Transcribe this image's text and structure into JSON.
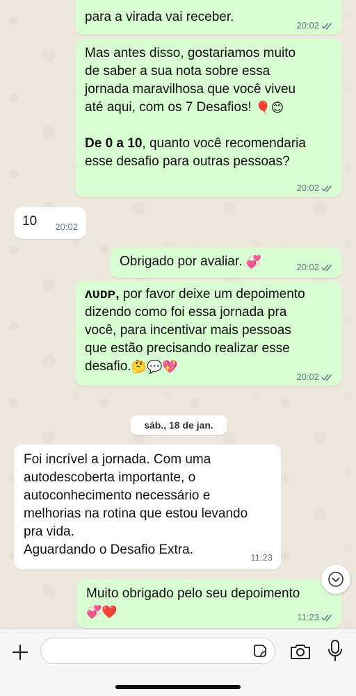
{
  "messages": [
    {
      "id": "m1",
      "text": "para a virada vai receber.",
      "time": "20:02"
    },
    {
      "id": "m2",
      "lines": [
        "Mas antes disso, gostariamos muito",
        "de saber a sua nota sobre essa",
        "jornada maravilhosa que você viveu",
        "até aqui, com os 7 Desafios!"
      ],
      "emoji_end": "🎈😊",
      "bold_part": "De 0 a 10",
      "after_bold": ", quanto você recomendaria",
      "last_line": "esse desafio para outras pessoas?",
      "time": "20:02"
    },
    {
      "id": "m3",
      "text": "10",
      "time": "20:02"
    },
    {
      "id": "m4",
      "text": "Obrigado por avaliar.",
      "emoji": "💞",
      "time": "20:02"
    },
    {
      "id": "m5",
      "name": "ᴧᴜᴅᴘ,",
      "first_rest": " por favor deixe um depoimento",
      "lines": [
        "dizendo como foi essa jornada pra",
        "você, para incentivar mais pessoas",
        "que estão precisando realizar esse"
      ],
      "last_line": "desafio.",
      "emoji": "🤔💬💖",
      "time": "20:02"
    },
    {
      "id": "m6",
      "lines": [
        "Foi incrível a jornada. Com uma",
        "autodescoberta importante, o",
        "autoconhecimento necessário e",
        "melhorias na rotina que estou levando",
        "pra vida.",
        "Aguardando o Desafio Extra."
      ],
      "time": "11:23"
    },
    {
      "id": "m7",
      "text": "Muito obrigado pelo seu depoimento",
      "emoji": "💞❤️",
      "time": "11:23"
    }
  ],
  "date_separator": "sáb., 18 de jan.",
  "icons": {
    "read_receipt": "double-check-icon",
    "scroll_down": "chevron-down-icon",
    "attach": "plus-icon",
    "sticker": "sticker-icon",
    "camera": "camera-icon",
    "mic": "microphone-icon"
  },
  "colors": {
    "outgoing": "#d9fdd3",
    "incoming": "#ffffff",
    "ticks": "#667781"
  }
}
